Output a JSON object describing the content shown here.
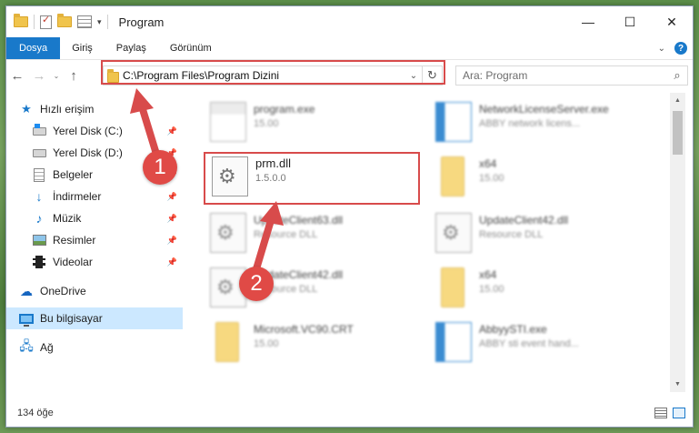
{
  "window": {
    "title": "Program",
    "controls": {
      "minimize": "—",
      "maximize": "☐",
      "close": "✕"
    }
  },
  "ribbon": {
    "tabs": [
      "Dosya",
      "Giriş",
      "Paylaş",
      "Görünüm"
    ]
  },
  "address_bar": {
    "path": "C:\\Program Files\\Program Dizini",
    "search_placeholder": "Ara: Program"
  },
  "nav_pane": {
    "quick_access": "Hızlı erişim",
    "items": [
      {
        "label": "Yerel Disk (C:)",
        "icon": "drive-c-icon",
        "pinned": true
      },
      {
        "label": "Yerel Disk (D:)",
        "icon": "drive-d-icon",
        "pinned": true
      },
      {
        "label": "Belgeler",
        "icon": "documents-icon",
        "pinned": true
      },
      {
        "label": "İndirmeler",
        "icon": "downloads-icon",
        "pinned": true
      },
      {
        "label": "Müzik",
        "icon": "music-icon",
        "pinned": true
      },
      {
        "label": "Resimler",
        "icon": "pictures-icon",
        "pinned": true
      },
      {
        "label": "Videolar",
        "icon": "videos-icon",
        "pinned": true
      }
    ],
    "onedrive": "OneDrive",
    "this_pc": "Bu bilgisayar",
    "network": "Ağ"
  },
  "files": [
    {
      "name": "program.exe",
      "sub": "15.00",
      "icon": "exe-icon",
      "blurred": true
    },
    {
      "name": "NetworkLicenseServer.exe",
      "sub": "ABBY network licens...",
      "icon": "exe-icon",
      "blurred": true
    },
    {
      "name": "prm.dll",
      "sub": "1.5.0.0",
      "icon": "dll-icon",
      "blurred": false
    },
    {
      "name": "x64",
      "sub": "15.00",
      "icon": "folder-icon",
      "blurred": true
    },
    {
      "name": "UpdateClient63.dll",
      "sub": "Resource DLL",
      "icon": "dll-icon",
      "blurred": true
    },
    {
      "name": "UpdateClient42.dll",
      "sub": "Resource DLL",
      "icon": "dll-icon",
      "blurred": true
    },
    {
      "name": "UpdateClient42.dll",
      "sub": "Resource DLL",
      "icon": "dll-icon",
      "blurred": true
    },
    {
      "name": "x64",
      "sub": "15.00",
      "icon": "folder-icon",
      "blurred": true
    },
    {
      "name": "Microsoft.VC90.CRT",
      "sub": "15.00",
      "icon": "folder-icon",
      "blurred": true
    },
    {
      "name": "AbbyySTI.exe",
      "sub": "ABBY sti event hand...",
      "icon": "exe-icon",
      "blurred": true
    }
  ],
  "status_bar": {
    "item_count": "134 öğe"
  },
  "annotations": {
    "marker_1": "1",
    "marker_2": "2",
    "highlight_color": "#d84b4b"
  },
  "colors": {
    "accent": "#1979ca",
    "selected_nav": "#cce8ff"
  }
}
